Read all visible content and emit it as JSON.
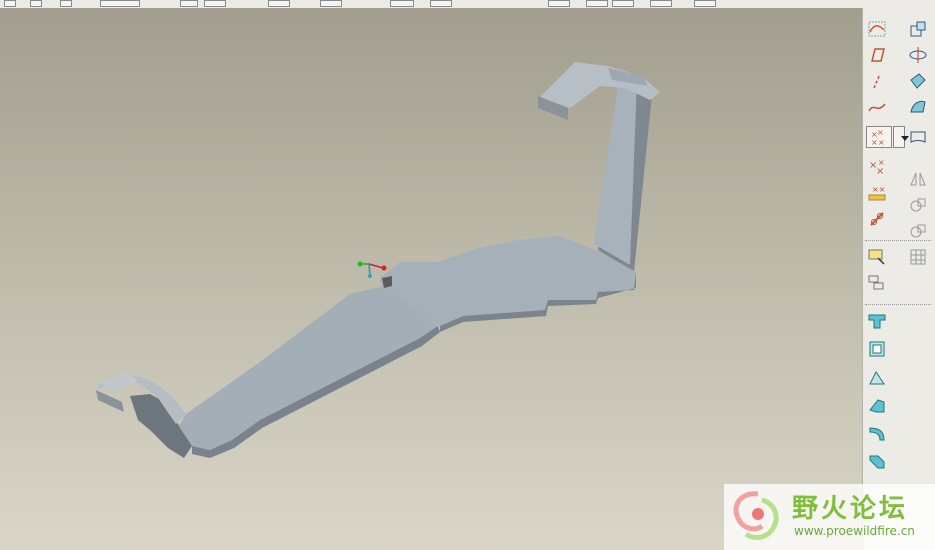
{
  "viewport": {
    "background_top": "#a29e8f",
    "background_bottom": "#d9d6c8",
    "model_color": "#a7b1b9",
    "model_shade": "#7c858d"
  },
  "right_toolbar": {
    "buttons": [
      {
        "icon": "sketched-datum-curve-icon"
      },
      {
        "icon": "datum-plane-icon"
      },
      {
        "icon": "datum-axis-icon"
      },
      {
        "icon": "datum-curve-icon"
      },
      {
        "icon": "datum-point-icon"
      },
      {
        "icon": "dropdown-arrow-icon"
      },
      {
        "icon": "offset-point-icon"
      },
      {
        "icon": "field-point-icon"
      },
      {
        "icon": "coordinate-system-icon"
      },
      {
        "icon": "insert-feature-icon"
      },
      {
        "icon": "copy-feature-icon"
      },
      {
        "icon": "unbend-icon"
      },
      {
        "icon": "bend-back-icon"
      },
      {
        "icon": "flat-wall-icon"
      },
      {
        "icon": "flange-wall-icon"
      },
      {
        "icon": "twist-icon"
      },
      {
        "icon": "edge-bend-icon"
      },
      {
        "icon": "scale-icon"
      },
      {
        "icon": "rotate-copy-icon"
      },
      {
        "icon": "offset-surface-icon"
      },
      {
        "icon": "boundary-blend-icon"
      },
      {
        "icon": "mirror-icon"
      },
      {
        "icon": "merge-icon"
      },
      {
        "icon": "trim-icon"
      },
      {
        "icon": "pattern-icon"
      }
    ]
  },
  "watermark": {
    "site_name": "野火论坛",
    "site_url": "www.proewildfire.cn"
  }
}
